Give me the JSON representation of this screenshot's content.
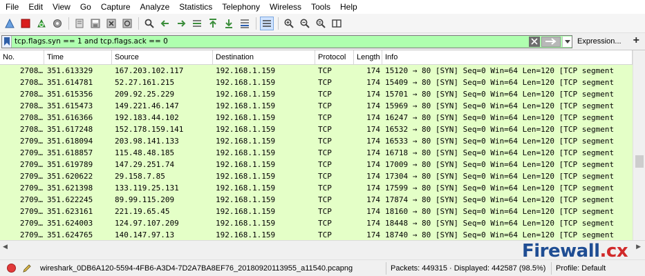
{
  "menu": [
    "File",
    "Edit",
    "View",
    "Go",
    "Capture",
    "Analyze",
    "Statistics",
    "Telephony",
    "Wireless",
    "Tools",
    "Help"
  ],
  "toolbar": {
    "icons": [
      "shark-fin-icon",
      "stop-icon",
      "restart-icon",
      "options-gear-icon",
      "open-file-icon",
      "save-file-icon",
      "close-file-icon",
      "reload-icon",
      "find-icon",
      "go-back-icon",
      "go-forward-icon",
      "go-to-packet-icon",
      "first-packet-icon",
      "last-packet-icon",
      "autoscroll-icon",
      "colorize-icon",
      "zoom-in-icon",
      "zoom-out-icon",
      "normal-size-icon",
      "resize-columns-icon"
    ]
  },
  "filter": {
    "value": "tcp.flags.syn == 1 and tcp.flags.ack == 0",
    "expression_label": "Expression...",
    "add_label": "+",
    "bg_color": "#afffaf"
  },
  "columns": [
    "No.",
    "Time",
    "Source",
    "Destination",
    "Protocol",
    "Length",
    "Info"
  ],
  "rows": [
    {
      "no": "2708…",
      "time": "351.613329",
      "src": "167.203.102.117",
      "dst": "192.168.1.159",
      "proto": "TCP",
      "len": "174",
      "info": "15120 → 80 [SYN] Seq=0 Win=64 Len=120 [TCP segment"
    },
    {
      "no": "2708…",
      "time": "351.614781",
      "src": "52.27.161.215",
      "dst": "192.168.1.159",
      "proto": "TCP",
      "len": "174",
      "info": "15409 → 80 [SYN] Seq=0 Win=64 Len=120 [TCP segment"
    },
    {
      "no": "2708…",
      "time": "351.615356",
      "src": "209.92.25.229",
      "dst": "192.168.1.159",
      "proto": "TCP",
      "len": "174",
      "info": "15701 → 80 [SYN] Seq=0 Win=64 Len=120 [TCP segment"
    },
    {
      "no": "2708…",
      "time": "351.615473",
      "src": "149.221.46.147",
      "dst": "192.168.1.159",
      "proto": "TCP",
      "len": "174",
      "info": "15969 → 80 [SYN] Seq=0 Win=64 Len=120 [TCP segment"
    },
    {
      "no": "2708…",
      "time": "351.616366",
      "src": "192.183.44.102",
      "dst": "192.168.1.159",
      "proto": "TCP",
      "len": "174",
      "info": "16247 → 80 [SYN] Seq=0 Win=64 Len=120 [TCP segment"
    },
    {
      "no": "2708…",
      "time": "351.617248",
      "src": "152.178.159.141",
      "dst": "192.168.1.159",
      "proto": "TCP",
      "len": "174",
      "info": "16532 → 80 [SYN] Seq=0 Win=64 Len=120 [TCP segment"
    },
    {
      "no": "2709…",
      "time": "351.618094",
      "src": "203.98.141.133",
      "dst": "192.168.1.159",
      "proto": "TCP",
      "len": "174",
      "info": "16533 → 80 [SYN] Seq=0 Win=64 Len=120 [TCP segment"
    },
    {
      "no": "2709…",
      "time": "351.618857",
      "src": "115.48.48.185",
      "dst": "192.168.1.159",
      "proto": "TCP",
      "len": "174",
      "info": "16718 → 80 [SYN] Seq=0 Win=64 Len=120 [TCP segment"
    },
    {
      "no": "2709…",
      "time": "351.619789",
      "src": "147.29.251.74",
      "dst": "192.168.1.159",
      "proto": "TCP",
      "len": "174",
      "info": "17009 → 80 [SYN] Seq=0 Win=64 Len=120 [TCP segment"
    },
    {
      "no": "2709…",
      "time": "351.620622",
      "src": "29.158.7.85",
      "dst": "192.168.1.159",
      "proto": "TCP",
      "len": "174",
      "info": "17304 → 80 [SYN] Seq=0 Win=64 Len=120 [TCP segment"
    },
    {
      "no": "2709…",
      "time": "351.621398",
      "src": "133.119.25.131",
      "dst": "192.168.1.159",
      "proto": "TCP",
      "len": "174",
      "info": "17599 → 80 [SYN] Seq=0 Win=64 Len=120 [TCP segment"
    },
    {
      "no": "2709…",
      "time": "351.622245",
      "src": "89.99.115.209",
      "dst": "192.168.1.159",
      "proto": "TCP",
      "len": "174",
      "info": "17874 → 80 [SYN] Seq=0 Win=64 Len=120 [TCP segment"
    },
    {
      "no": "2709…",
      "time": "351.623161",
      "src": "221.19.65.45",
      "dst": "192.168.1.159",
      "proto": "TCP",
      "len": "174",
      "info": "18160 → 80 [SYN] Seq=0 Win=64 Len=120 [TCP segment"
    },
    {
      "no": "2709…",
      "time": "351.624003",
      "src": "124.97.107.209",
      "dst": "192.168.1.159",
      "proto": "TCP",
      "len": "174",
      "info": "18448 → 80 [SYN] Seq=0 Win=64 Len=120 [TCP segment"
    },
    {
      "no": "2709…",
      "time": "351.624765",
      "src": "140.147.97.13",
      "dst": "192.168.1.159",
      "proto": "TCP",
      "len": "174",
      "info": "18740 → 80 [SYN] Seq=0 Win=64 Len=120 [TCP segment"
    }
  ],
  "row_color": "#e4ffc7",
  "status": {
    "file": "wireshark_0DB6A120-5594-4FB6-A3D4-7D2A7BA8EF76_20180920113955_a11540.pcapng",
    "packets": "Packets: 449315 · Displayed: 442587 (98.5%)",
    "profile": "Profile: Default"
  },
  "watermark": {
    "text": "Firewall",
    "suffix": ".cx"
  }
}
